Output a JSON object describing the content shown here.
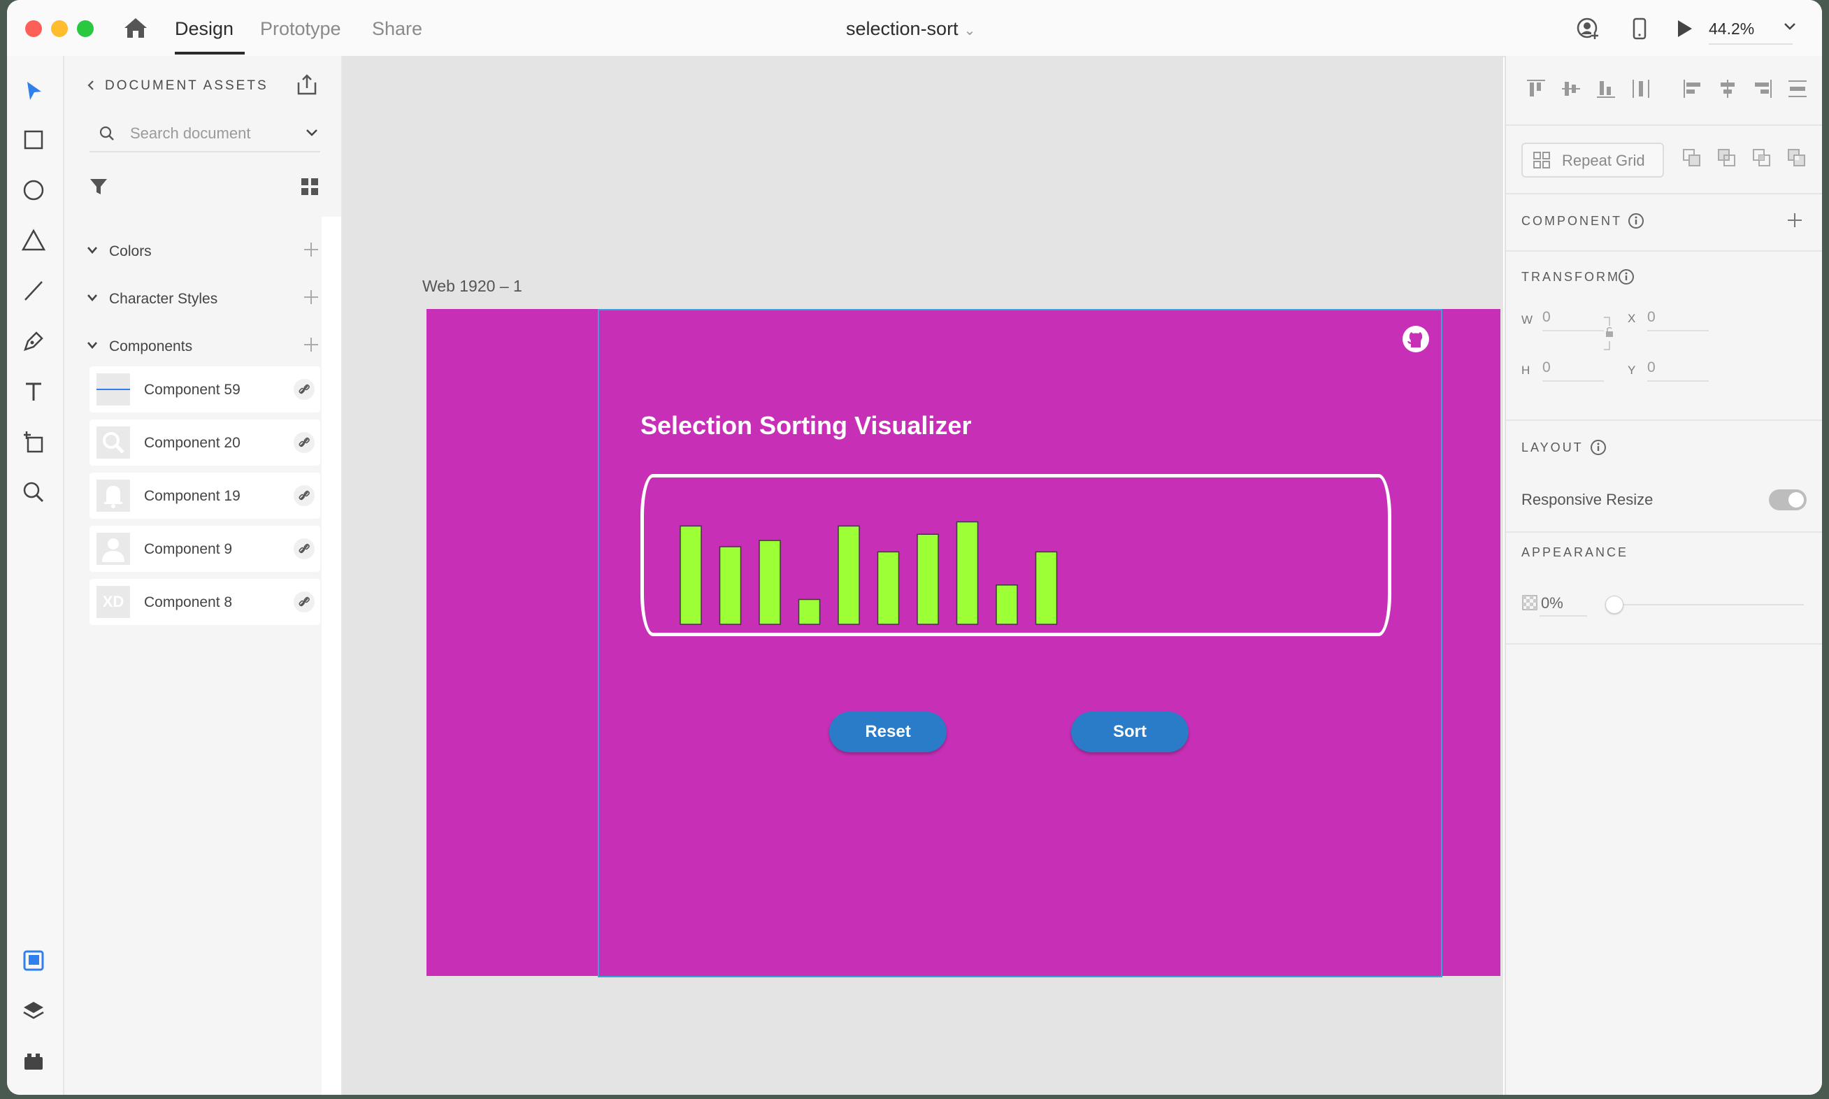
{
  "header": {
    "tabs": [
      {
        "label": "Design",
        "active": true
      },
      {
        "label": "Prototype",
        "active": false
      },
      {
        "label": "Share",
        "active": false
      }
    ],
    "document_title": "selection-sort",
    "zoom": "44.2%"
  },
  "assets": {
    "title": "DOCUMENT ASSETS",
    "search_placeholder": "Search document",
    "sections": [
      {
        "label": "Colors"
      },
      {
        "label": "Character Styles"
      },
      {
        "label": "Components"
      }
    ],
    "components": [
      {
        "label": "Component 59",
        "thumb": "line-icon"
      },
      {
        "label": "Component 20",
        "thumb": "search-icon"
      },
      {
        "label": "Component 19",
        "thumb": "bell-icon"
      },
      {
        "label": "Component 9",
        "thumb": "user-icon"
      },
      {
        "label": "Component 8",
        "thumb": "xd-logo"
      }
    ]
  },
  "canvas": {
    "artboard_label": "Web 1920 – 1",
    "artboard_color": "#c730b6",
    "title": "Selection Sorting Visualizer",
    "reset_label": "Reset",
    "sort_label": "Sort",
    "bar_color": "#9dff36",
    "button_color": "#2a7bc8",
    "bars": [
      0.95,
      0.75,
      0.81,
      0.24,
      0.95,
      0.7,
      0.87,
      0.99,
      0.38,
      0.7
    ]
  },
  "properties": {
    "repeat_grid_label": "Repeat Grid",
    "component_heading": "COMPONENT",
    "transform_heading": "TRANSFORM",
    "w_label": "W",
    "w_value": "0",
    "x_label": "X",
    "x_value": "0",
    "h_label": "H",
    "h_value": "0",
    "y_label": "Y",
    "y_value": "0",
    "layout_heading": "LAYOUT",
    "responsive_resize_label": "Responsive Resize",
    "appearance_heading": "APPEARANCE",
    "opacity_value": "0%"
  }
}
